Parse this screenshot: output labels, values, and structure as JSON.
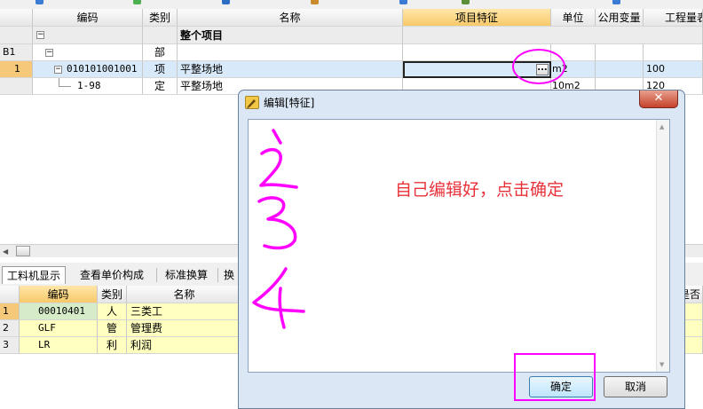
{
  "main_table": {
    "headers": [
      "编码",
      "类别",
      "名称",
      "项目特征",
      "单位",
      "公用变量",
      "工程量表"
    ],
    "section_label": "整个项目",
    "rows": [
      {
        "num": "B1",
        "code": "",
        "type": "部",
        "name": "",
        "feature": "",
        "unit": "",
        "qty": ""
      },
      {
        "num": "1",
        "code": "010101001001",
        "type": "项",
        "name": "平整场地",
        "feature": "",
        "unit": "m2",
        "qty": "100"
      },
      {
        "num": "",
        "code": "1-98",
        "type": "定",
        "name": "平整场地",
        "feature": "",
        "unit": "10m2",
        "qty": "120"
      }
    ],
    "ellipsis_label": "..."
  },
  "bottom_tabs": [
    "工料机显示",
    "查看单价构成",
    "标准换算",
    "换"
  ],
  "bottom_table": {
    "headers": [
      "编码",
      "类别",
      "名称"
    ],
    "right_header_fragment": "是否",
    "rows": [
      {
        "num": "1",
        "code": "00010401",
        "type": "人",
        "name": "三类工"
      },
      {
        "num": "2",
        "code": "GLF",
        "type": "管",
        "name": "管理费"
      },
      {
        "num": "3",
        "code": "LR",
        "type": "利",
        "name": "利润"
      }
    ]
  },
  "dialog": {
    "title": "编辑[特征]",
    "handwriting": [
      "1",
      "2",
      "3",
      "4"
    ],
    "annotation": "自己编辑好，点击确定",
    "ok_label": "确定",
    "cancel_label": "取消"
  },
  "colors": {
    "selected_row": "#d8eaf9",
    "header_highlight": "#f7c96a",
    "bottom_row": "#ffffc0",
    "annotation_red": "#e8323a",
    "marker_magenta": "#ff00ff"
  }
}
